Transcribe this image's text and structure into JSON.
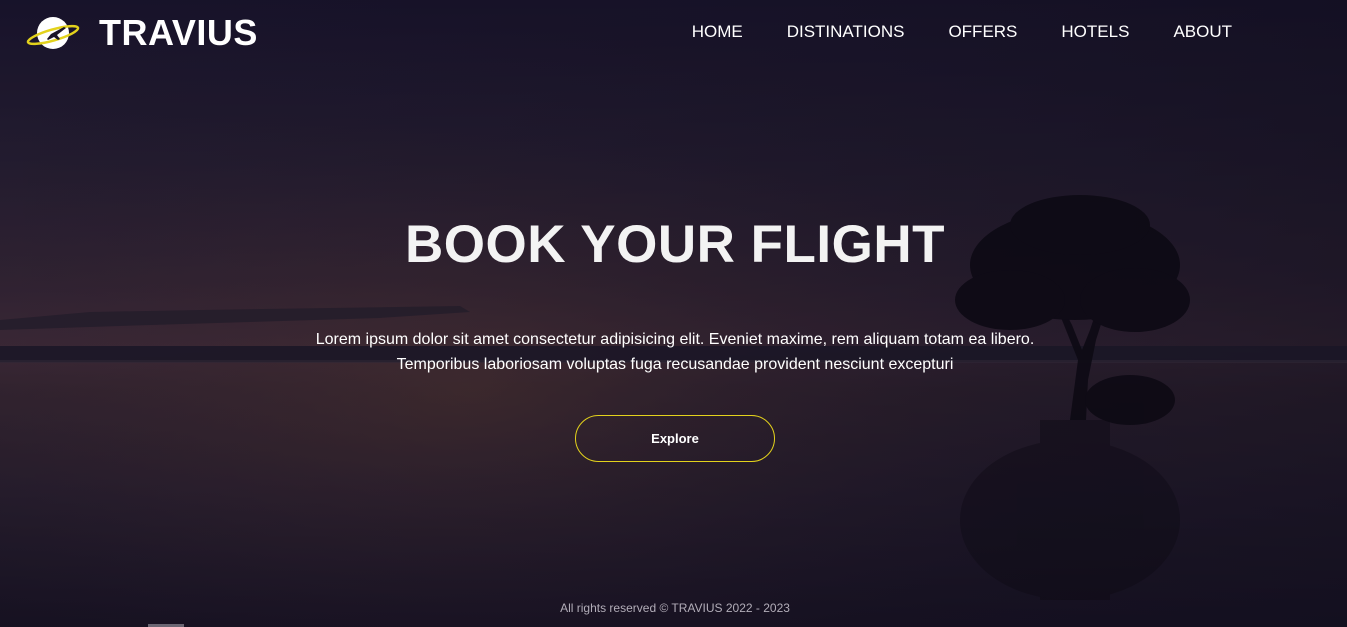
{
  "header": {
    "brand": "TRAVIUS",
    "logo_icon": "planet-airplane-icon",
    "nav": [
      {
        "label": "HOME"
      },
      {
        "label": "DISTINATIONS"
      },
      {
        "label": "OFFERS"
      },
      {
        "label": "HOTELS"
      },
      {
        "label": "ABOUT"
      }
    ]
  },
  "hero": {
    "title": "BOOK YOUR FLIGHT",
    "text_line1": "Lorem ipsum dolor sit amet consectetur adipisicing elit. Eveniet maxime, rem aliquam totam ea libero.",
    "text_line2": "Temporibus laboriosam voluptas fuga recusandae provident nesciunt excepturi",
    "button_label": "Explore"
  },
  "footer": {
    "text": "All rights reserved © TRAVIUS 2022 - 2023"
  },
  "colors": {
    "accent": "#e3d21c",
    "text": "#ffffff",
    "sky_dark": "#1a1428"
  }
}
